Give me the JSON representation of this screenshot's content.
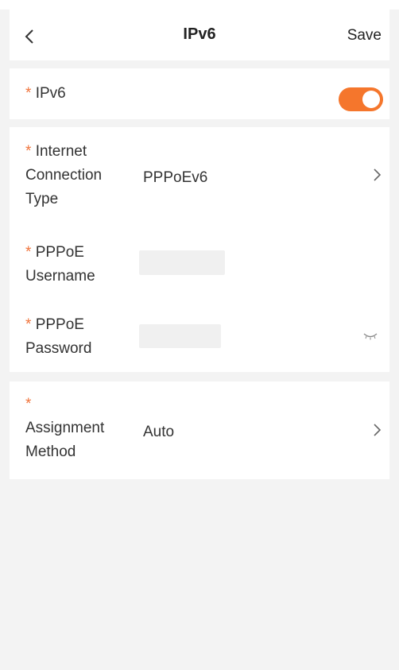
{
  "header": {
    "title": "IPv6",
    "save_label": "Save"
  },
  "required_mark": "*",
  "ipv6_row": {
    "label": "IPv6",
    "enabled": true
  },
  "connection": {
    "type_label_lines": [
      "Internet",
      "Connection",
      "Type"
    ],
    "type_value": "PPPoEv6",
    "username_label_lines": [
      "PPPoE",
      "Username"
    ],
    "username_value": "",
    "password_label_lines": [
      "PPPoE",
      "Password"
    ],
    "password_value": ""
  },
  "assignment": {
    "label_lines": [
      "Assignment",
      "Method"
    ],
    "value": "Auto"
  },
  "colors": {
    "accent": "#f5762c",
    "background": "#f3f3f3",
    "card": "#ffffff"
  }
}
